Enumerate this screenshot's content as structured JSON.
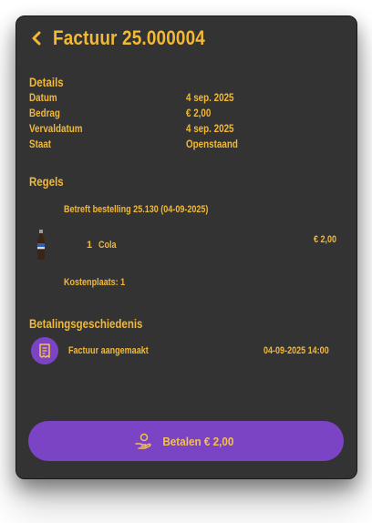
{
  "header": {
    "back_icon": "chevron-left-icon",
    "title": "Factuur 25.000004"
  },
  "details": {
    "section_title": "Details",
    "rows": [
      {
        "label": "Datum",
        "value": "4 sep. 2025"
      },
      {
        "label": "Bedrag",
        "value": "€ 2,00"
      },
      {
        "label": "Vervaldatum",
        "value": "4 sep. 2025"
      },
      {
        "label": "Staat",
        "value": "Openstaand"
      }
    ]
  },
  "regels": {
    "section_title": "Regels",
    "order_ref": "Betreft bestelling 25.130 (04-09-2025)",
    "item": {
      "quantity": "1",
      "name": "Cola",
      "price": "€ 2,00",
      "icon": "cola-bottle-icon"
    },
    "cost_center": "Kostenplaats: 1"
  },
  "history": {
    "section_title": "Betalingsgeschiedenis",
    "entries": [
      {
        "icon": "receipt-icon",
        "text": "Factuur aangemaakt",
        "datetime": "04-09-2025 14:00"
      }
    ]
  },
  "pay_button": {
    "icon": "hand-coin-icon",
    "label": "Betalen € 2,00"
  },
  "colors": {
    "accent": "#f3b934",
    "purple": "#7a44c4",
    "card_bg": "#333333"
  }
}
